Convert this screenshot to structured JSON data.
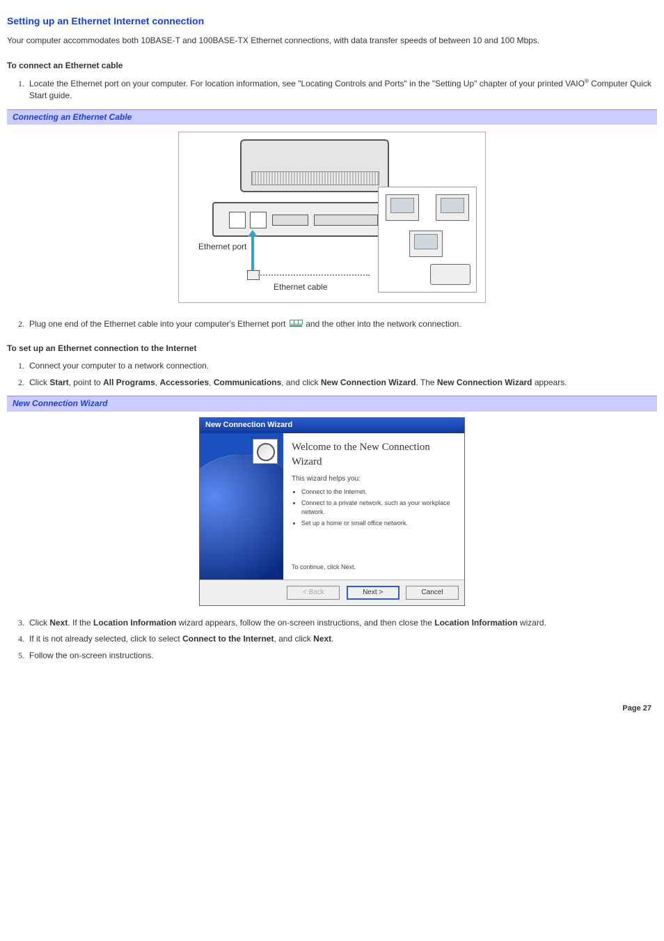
{
  "title": "Setting up an Ethernet Internet connection",
  "intro": "Your computer accommodates both 10BASE-T and 100BASE-TX Ethernet connections, with data transfer speeds of between 10 and 100 Mbps.",
  "section1": {
    "heading": "To connect an Ethernet cable",
    "step1_a": "Locate the Ethernet port on your computer. For location information, see \"Locating Controls and Ports\" in the \"Setting Up\" chapter of your printed VAIO",
    "step1_b": " Computer Quick Start guide.",
    "reg": "®"
  },
  "caption1": "Connecting an Ethernet Cable",
  "diagram": {
    "port_label": "Ethernet port",
    "cable_label": "Ethernet cable"
  },
  "step2": {
    "a": "Plug one end of the Ethernet cable into your computer's Ethernet port ",
    "b": "and the other into the network connection."
  },
  "section2": {
    "heading": "To set up an Ethernet connection to the Internet",
    "s1": "Connect your computer to a network connection.",
    "s2_a": "Click ",
    "s2_start": "Start",
    "s2_b": ", point to ",
    "s2_allprog": "All Programs",
    "s2_c": ", ",
    "s2_acc": "Accessories",
    "s2_comm": "Communications",
    "s2_d": ", and click ",
    "s2_ncw": "New Connection Wizard",
    "s2_e": ". The ",
    "s2_ncw2": "New Connection Wizard",
    "s2_f": " appears."
  },
  "caption2": "New Connection Wizard",
  "wizard": {
    "titlebar": "New Connection Wizard",
    "heading": "Welcome to the New Connection Wizard",
    "helps": "This wizard helps you:",
    "b1": "Connect to the Internet.",
    "b2": "Connect to a private network, such as your workplace network.",
    "b3": "Set up a home or small office network.",
    "cont": "To continue, click Next.",
    "back": "< Back",
    "next": "Next >",
    "cancel": "Cancel"
  },
  "step3": {
    "a": "Click ",
    "next": "Next",
    "b": ". If the ",
    "li": "Location Information",
    "c": " wizard appears, follow the on-screen instructions, and then close the ",
    "li2": "Location Information",
    "d": " wizard."
  },
  "step4": {
    "a": "If it is not already selected, click to select ",
    "cti": "Connect to the Internet",
    "b": ", and click ",
    "next": "Next",
    "c": "."
  },
  "step5": "Follow the on-screen instructions.",
  "page": "Page 27"
}
